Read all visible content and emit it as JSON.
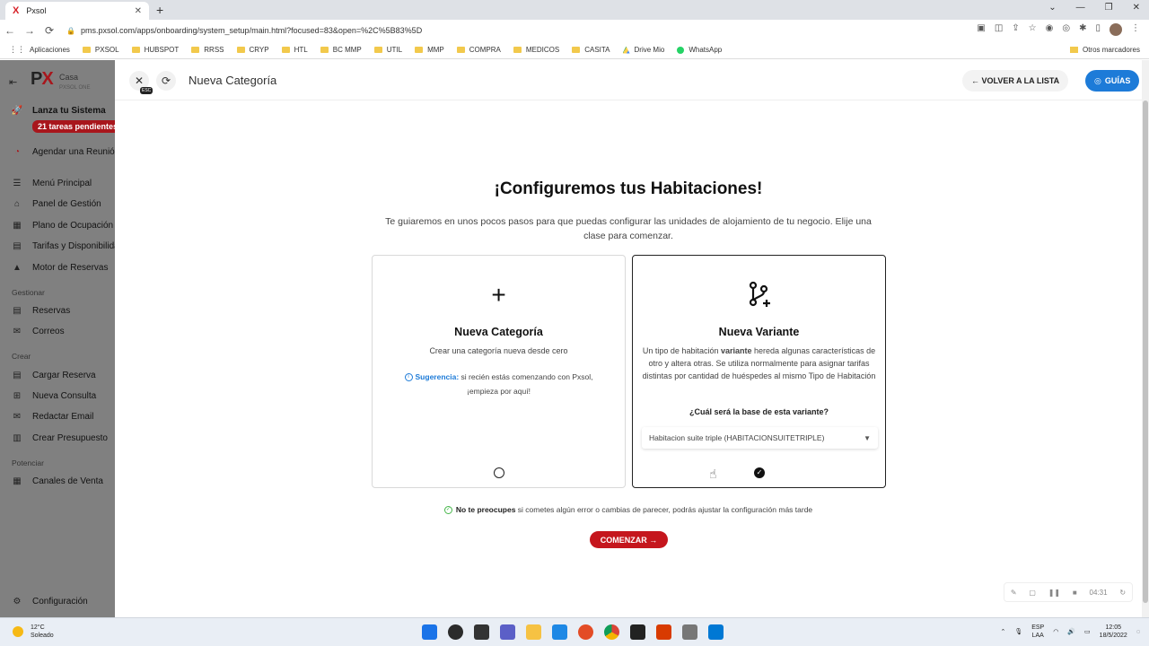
{
  "browser": {
    "tab_title": "Pxsol",
    "tab_favicon": "X",
    "url": "pms.pxsol.com/apps/onboarding/system_setup/main.html?focused=83&open=%2C%5B83%5D",
    "bookmarks": [
      "Aplicaciones",
      "PXSOL",
      "HUBSPOT",
      "RRSS",
      "CRYP",
      "HTL",
      "BC MMP",
      "UTIL",
      "MMP",
      "COMPRA",
      "MEDICOS",
      "CASITA",
      "Drive Mio",
      "WhatsApp"
    ],
    "other_bookmarks": "Otros marcadores"
  },
  "sidebar": {
    "logo_p": "P",
    "logo_x": "X",
    "property": "Casa",
    "product": "PXSOL ONE",
    "launch_label": "Lanza tu Sistema",
    "pending_badge": "21 tareas pendientes",
    "meeting_label": "Agendar una Reunión",
    "main_items": [
      "Menú Principal",
      "Panel de Gestión",
      "Plano de Ocupación",
      "Tarifas y Disponibilidad",
      "Motor de Reservas"
    ],
    "section_manage": "Gestionar",
    "manage_items": [
      "Reservas",
      "Correos"
    ],
    "section_create": "Crear",
    "create_items": [
      "Cargar Reserva",
      "Nueva Consulta",
      "Redactar Email",
      "Crear Presupuesto"
    ],
    "section_boost": "Potenciar",
    "boost_items": [
      "Canales de Venta"
    ],
    "settings_label": "Configuración"
  },
  "header": {
    "esc_label": "ESC",
    "title": "Nueva Categoría",
    "back_label": "← VOLVER A LA LISTA",
    "guides_label": "GUÍAS"
  },
  "content": {
    "heading": "¡Configuremos tus Habitaciones!",
    "lead": "Te guiaremos en unos pocos pasos para que puedas configurar las unidades de alojamiento de tu negocio. Elije una clase para comenzar.",
    "card_new": {
      "icon": "+",
      "title": "Nueva Categoría",
      "desc": "Crear una categoría nueva desde cero",
      "tip_label": "Sugerencia:",
      "tip_text": " si recién estás comenzando con Pxsol, ¡empieza por aquí!"
    },
    "card_variant": {
      "title": "Nueva Variante",
      "desc_1": "Un tipo de habitación ",
      "desc_bold": "variante",
      "desc_2": " hereda algunas características de otro y altera otras. Se utiliza normalmente para asignar tarifas distintas por cantidad de huéspedes al mismo Tipo de Habitación",
      "question": "¿Cuál será la base de esta variante?",
      "select_value": "Habitacion suite triple (HABITACIONSUITETRIPLE)",
      "selected": true
    },
    "note_bold": "No te preocupes",
    "note_text": " si cometes algún error o cambias de parecer, podrás ajustar la configuración más tarde",
    "start_label": "COMENZAR →"
  },
  "recorder": {
    "time": "04:31"
  },
  "taskbar": {
    "temperature": "12°C",
    "weather": "Soleado",
    "lang": "ESP",
    "lang_sub": "LAA",
    "time": "12:05",
    "date": "18/5/2022"
  },
  "colors": {
    "brand_red": "#c5161d",
    "accent_blue": "#1d7bd8",
    "sidebar_overlay": "#808080"
  }
}
